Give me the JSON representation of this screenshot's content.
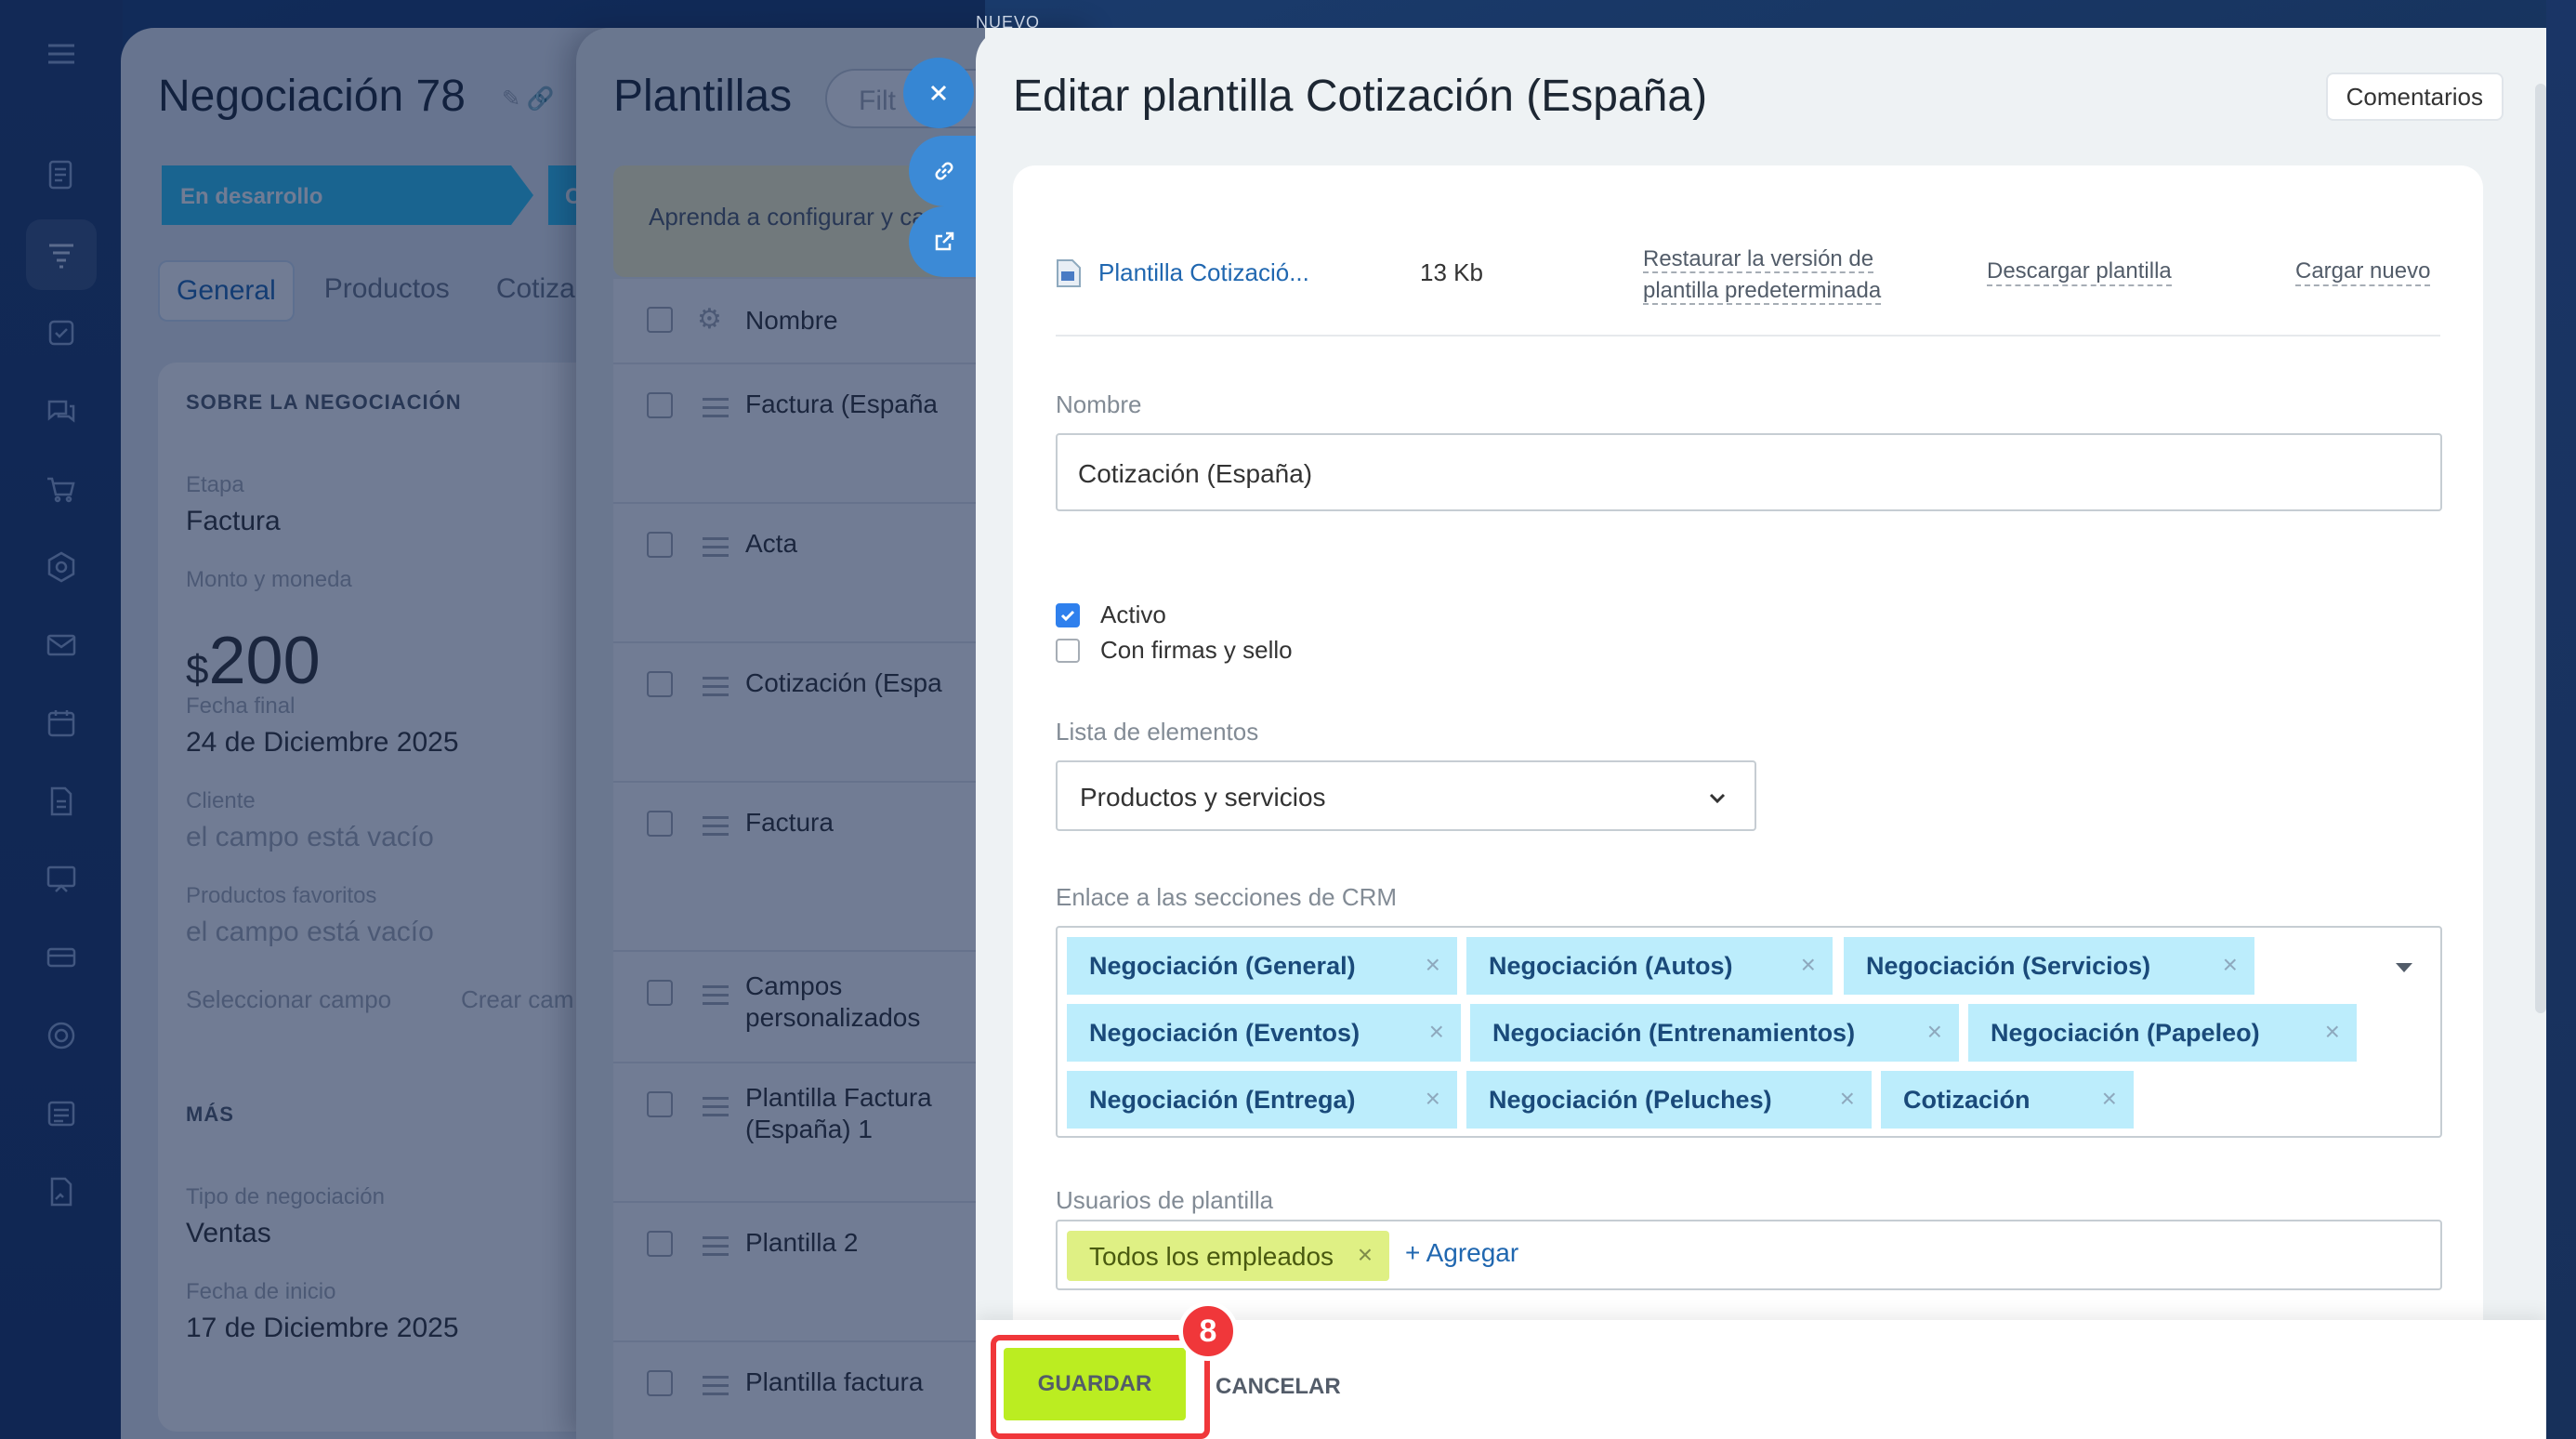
{
  "nuevo_label": "NUEVO",
  "deal": {
    "title": "Negociación 78",
    "stage_label": "En desarrollo",
    "stage_next": "C",
    "tabs": [
      "General",
      "Productos",
      "Cotiza"
    ],
    "section_about": "SOBRE LA NEGOCIACIÓN",
    "stage_field_label": "Etapa",
    "stage_field_value": "Factura",
    "amount_label": "Monto y moneda",
    "amount_currency": "$",
    "amount_value": "200",
    "end_date_label": "Fecha final",
    "end_date_value": "24 de Diciembre 2025",
    "client_label": "Cliente",
    "client_value": "el campo está vacío",
    "fav_label": "Productos favoritos",
    "fav_value": "el campo está vacío",
    "select_field": "Seleccionar campo",
    "create_field": "Crear cam",
    "section_more": "MÁS",
    "type_label": "Tipo de negociación",
    "type_value": "Ventas",
    "start_label": "Fecha de inicio",
    "start_value": "17 de Diciembre 2025"
  },
  "templates_list": {
    "title": "Plantillas",
    "filter_placeholder": "Filt",
    "banner": "Aprenda a configurar y carga",
    "column_name": "Nombre",
    "rows": [
      "Factura (España",
      "Acta",
      "Cotización (Espa",
      "Factura",
      "Campos personalizados",
      "Plantilla Factura (España) 1",
      "Plantilla 2",
      "Plantilla factura"
    ]
  },
  "editor": {
    "title": "Editar plantilla Cotización (España)",
    "comments_button": "Comentarios",
    "file": {
      "name": "Plantilla Cotizació...",
      "size": "13 Kb",
      "restore_line1": "Restaurar la versión de",
      "restore_line2": "plantilla predeterminada",
      "download": "Descargar plantilla",
      "upload": "Cargar nuevo"
    },
    "name_label": "Nombre",
    "name_value": "Cotización (España)",
    "active_label": "Activo",
    "signatures_label": "Con firmas y sello",
    "elements_label": "Lista de elementos",
    "elements_value": "Productos y servicios",
    "crm_label": "Enlace a las secciones de CRM",
    "crm_tags": [
      "Negociación (General)",
      "Negociación (Autos)",
      "Negociación (Servicios)",
      "Negociación (Eventos)",
      "Negociación (Entrenamientos)",
      "Negociación (Papeleo)",
      "Negociación (Entrega)",
      "Negociación (Peluches)",
      "Cotización"
    ],
    "users_label": "Usuarios de plantilla",
    "users_tag": "Todos los empleados",
    "add_link": "+ Agregar",
    "save_button": "GUARDAR",
    "cancel_button": "CANCELAR",
    "step_number": "8"
  },
  "colors": {
    "accent_blue": "#2067b0",
    "tag_blue": "#bcedfc",
    "save_green": "#bbed21",
    "highlight_red": "#f0373a"
  }
}
